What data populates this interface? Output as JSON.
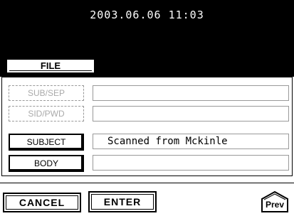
{
  "header": {
    "datetime": "2003.06.06 11:03"
  },
  "tabs": {
    "file_label": "FILE"
  },
  "form": {
    "rows": [
      {
        "label": "SUB/SEP",
        "value": ""
      },
      {
        "label": "SID/PWD",
        "value": ""
      },
      {
        "label": "SUBJECT",
        "value": "Scanned from Mckinle"
      },
      {
        "label": "BODY",
        "value": ""
      }
    ]
  },
  "footer": {
    "cancel_label": "CANCEL",
    "enter_label": "ENTER",
    "prev_label": "Prev"
  }
}
